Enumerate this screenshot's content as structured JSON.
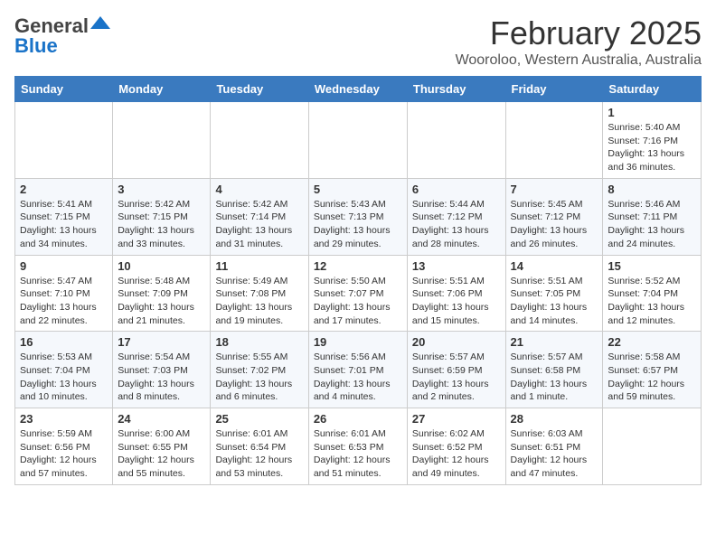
{
  "header": {
    "logo_line1": "General",
    "logo_line2": "Blue",
    "month": "February 2025",
    "location": "Wooroloo, Western Australia, Australia"
  },
  "weekdays": [
    "Sunday",
    "Monday",
    "Tuesday",
    "Wednesday",
    "Thursday",
    "Friday",
    "Saturday"
  ],
  "weeks": [
    [
      {
        "day": "",
        "sunrise": "",
        "sunset": "",
        "daylight": ""
      },
      {
        "day": "",
        "sunrise": "",
        "sunset": "",
        "daylight": ""
      },
      {
        "day": "",
        "sunrise": "",
        "sunset": "",
        "daylight": ""
      },
      {
        "day": "",
        "sunrise": "",
        "sunset": "",
        "daylight": ""
      },
      {
        "day": "",
        "sunrise": "",
        "sunset": "",
        "daylight": ""
      },
      {
        "day": "",
        "sunrise": "",
        "sunset": "",
        "daylight": ""
      },
      {
        "day": "1",
        "sunrise": "Sunrise: 5:40 AM",
        "sunset": "Sunset: 7:16 PM",
        "daylight": "Daylight: 13 hours and 36 minutes."
      }
    ],
    [
      {
        "day": "2",
        "sunrise": "Sunrise: 5:41 AM",
        "sunset": "Sunset: 7:15 PM",
        "daylight": "Daylight: 13 hours and 34 minutes."
      },
      {
        "day": "3",
        "sunrise": "Sunrise: 5:42 AM",
        "sunset": "Sunset: 7:15 PM",
        "daylight": "Daylight: 13 hours and 33 minutes."
      },
      {
        "day": "4",
        "sunrise": "Sunrise: 5:42 AM",
        "sunset": "Sunset: 7:14 PM",
        "daylight": "Daylight: 13 hours and 31 minutes."
      },
      {
        "day": "5",
        "sunrise": "Sunrise: 5:43 AM",
        "sunset": "Sunset: 7:13 PM",
        "daylight": "Daylight: 13 hours and 29 minutes."
      },
      {
        "day": "6",
        "sunrise": "Sunrise: 5:44 AM",
        "sunset": "Sunset: 7:12 PM",
        "daylight": "Daylight: 13 hours and 28 minutes."
      },
      {
        "day": "7",
        "sunrise": "Sunrise: 5:45 AM",
        "sunset": "Sunset: 7:12 PM",
        "daylight": "Daylight: 13 hours and 26 minutes."
      },
      {
        "day": "8",
        "sunrise": "Sunrise: 5:46 AM",
        "sunset": "Sunset: 7:11 PM",
        "daylight": "Daylight: 13 hours and 24 minutes."
      }
    ],
    [
      {
        "day": "9",
        "sunrise": "Sunrise: 5:47 AM",
        "sunset": "Sunset: 7:10 PM",
        "daylight": "Daylight: 13 hours and 22 minutes."
      },
      {
        "day": "10",
        "sunrise": "Sunrise: 5:48 AM",
        "sunset": "Sunset: 7:09 PM",
        "daylight": "Daylight: 13 hours and 21 minutes."
      },
      {
        "day": "11",
        "sunrise": "Sunrise: 5:49 AM",
        "sunset": "Sunset: 7:08 PM",
        "daylight": "Daylight: 13 hours and 19 minutes."
      },
      {
        "day": "12",
        "sunrise": "Sunrise: 5:50 AM",
        "sunset": "Sunset: 7:07 PM",
        "daylight": "Daylight: 13 hours and 17 minutes."
      },
      {
        "day": "13",
        "sunrise": "Sunrise: 5:51 AM",
        "sunset": "Sunset: 7:06 PM",
        "daylight": "Daylight: 13 hours and 15 minutes."
      },
      {
        "day": "14",
        "sunrise": "Sunrise: 5:51 AM",
        "sunset": "Sunset: 7:05 PM",
        "daylight": "Daylight: 13 hours and 14 minutes."
      },
      {
        "day": "15",
        "sunrise": "Sunrise: 5:52 AM",
        "sunset": "Sunset: 7:04 PM",
        "daylight": "Daylight: 13 hours and 12 minutes."
      }
    ],
    [
      {
        "day": "16",
        "sunrise": "Sunrise: 5:53 AM",
        "sunset": "Sunset: 7:04 PM",
        "daylight": "Daylight: 13 hours and 10 minutes."
      },
      {
        "day": "17",
        "sunrise": "Sunrise: 5:54 AM",
        "sunset": "Sunset: 7:03 PM",
        "daylight": "Daylight: 13 hours and 8 minutes."
      },
      {
        "day": "18",
        "sunrise": "Sunrise: 5:55 AM",
        "sunset": "Sunset: 7:02 PM",
        "daylight": "Daylight: 13 hours and 6 minutes."
      },
      {
        "day": "19",
        "sunrise": "Sunrise: 5:56 AM",
        "sunset": "Sunset: 7:01 PM",
        "daylight": "Daylight: 13 hours and 4 minutes."
      },
      {
        "day": "20",
        "sunrise": "Sunrise: 5:57 AM",
        "sunset": "Sunset: 6:59 PM",
        "daylight": "Daylight: 13 hours and 2 minutes."
      },
      {
        "day": "21",
        "sunrise": "Sunrise: 5:57 AM",
        "sunset": "Sunset: 6:58 PM",
        "daylight": "Daylight: 13 hours and 1 minute."
      },
      {
        "day": "22",
        "sunrise": "Sunrise: 5:58 AM",
        "sunset": "Sunset: 6:57 PM",
        "daylight": "Daylight: 12 hours and 59 minutes."
      }
    ],
    [
      {
        "day": "23",
        "sunrise": "Sunrise: 5:59 AM",
        "sunset": "Sunset: 6:56 PM",
        "daylight": "Daylight: 12 hours and 57 minutes."
      },
      {
        "day": "24",
        "sunrise": "Sunrise: 6:00 AM",
        "sunset": "Sunset: 6:55 PM",
        "daylight": "Daylight: 12 hours and 55 minutes."
      },
      {
        "day": "25",
        "sunrise": "Sunrise: 6:01 AM",
        "sunset": "Sunset: 6:54 PM",
        "daylight": "Daylight: 12 hours and 53 minutes."
      },
      {
        "day": "26",
        "sunrise": "Sunrise: 6:01 AM",
        "sunset": "Sunset: 6:53 PM",
        "daylight": "Daylight: 12 hours and 51 minutes."
      },
      {
        "day": "27",
        "sunrise": "Sunrise: 6:02 AM",
        "sunset": "Sunset: 6:52 PM",
        "daylight": "Daylight: 12 hours and 49 minutes."
      },
      {
        "day": "28",
        "sunrise": "Sunrise: 6:03 AM",
        "sunset": "Sunset: 6:51 PM",
        "daylight": "Daylight: 12 hours and 47 minutes."
      },
      {
        "day": "",
        "sunrise": "",
        "sunset": "",
        "daylight": ""
      }
    ]
  ]
}
